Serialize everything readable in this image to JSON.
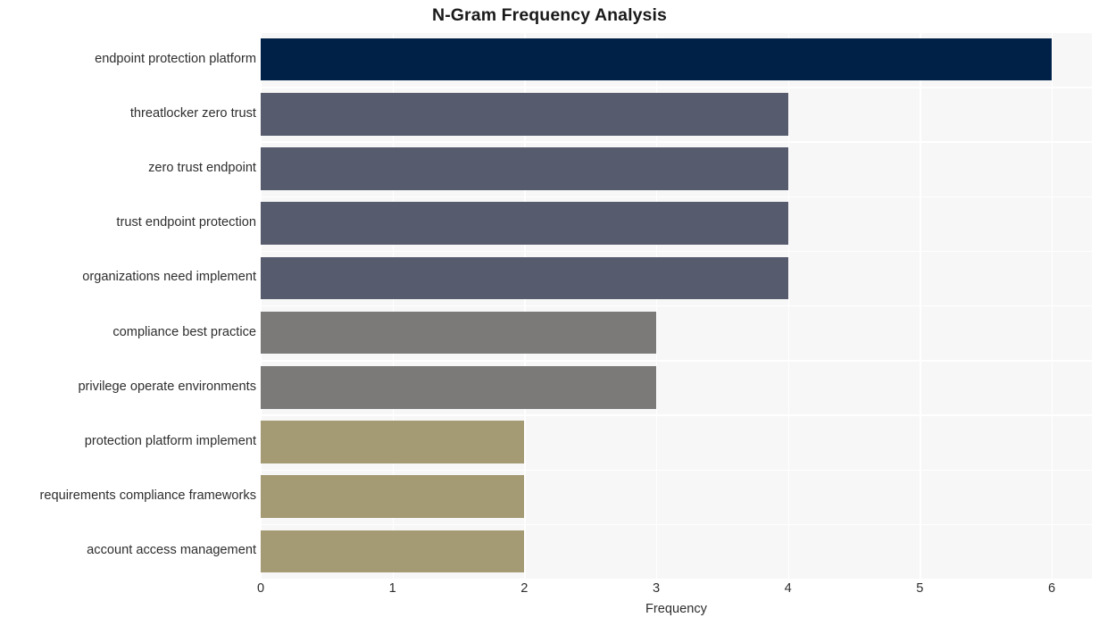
{
  "chart_data": {
    "type": "bar",
    "orientation": "horizontal",
    "title": "N-Gram Frequency Analysis",
    "xlabel": "Frequency",
    "ylabel": "",
    "categories": [
      "endpoint protection platform",
      "threatlocker zero trust",
      "zero trust endpoint",
      "trust endpoint protection",
      "organizations need implement",
      "compliance best practice",
      "privilege operate environments",
      "protection platform implement",
      "requirements compliance frameworks",
      "account access management"
    ],
    "values": [
      6,
      4,
      4,
      4,
      4,
      3,
      3,
      2,
      2,
      2
    ],
    "bar_colors": [
      "#002147",
      "#565c6e",
      "#565c6e",
      "#565c6e",
      "#565c6e",
      "#7b7a78",
      "#7b7a78",
      "#a49a73",
      "#a49a73",
      "#a49a73"
    ],
    "xlim": [
      0,
      6
    ],
    "xticks": [
      0,
      1,
      2,
      3,
      4,
      5,
      6
    ],
    "xtick_labels": [
      "0",
      "1",
      "2",
      "3",
      "4",
      "5",
      "6"
    ],
    "grid": true,
    "grid_color": "#ffffff",
    "plot_background": "#f7f7f7",
    "figure_background": "#ffffff",
    "legend": null
  }
}
